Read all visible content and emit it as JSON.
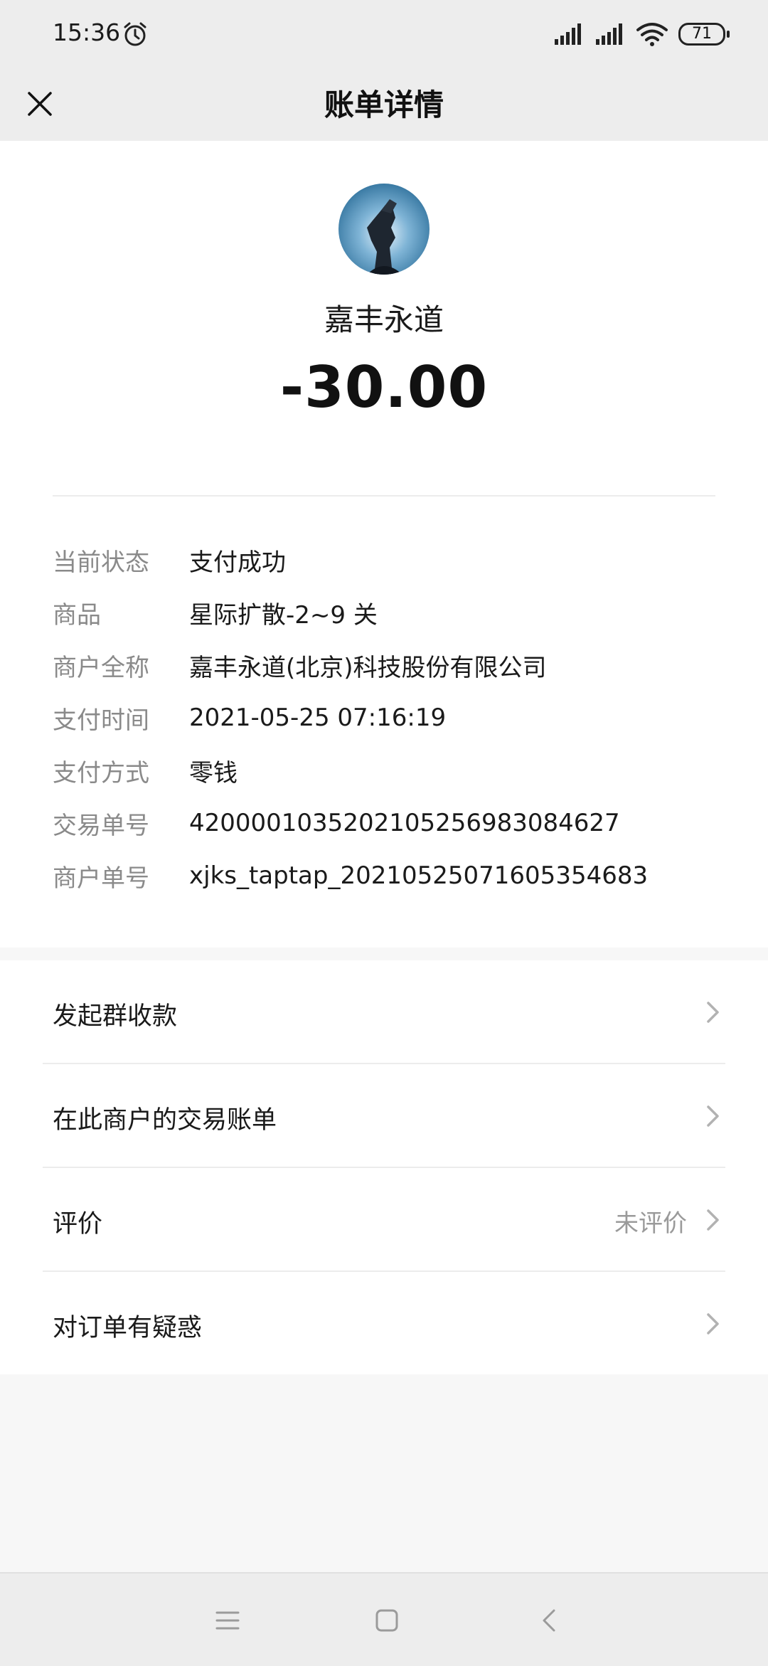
{
  "status_bar": {
    "time": "15:36",
    "battery": "71",
    "icons": [
      "alarm-icon",
      "signal-icon",
      "signal-icon",
      "wifi-icon",
      "battery-icon"
    ]
  },
  "header": {
    "title": "账单详情",
    "close_icon": "close-icon"
  },
  "summary": {
    "merchant": "嘉丰永道",
    "amount": "-30.00"
  },
  "details": [
    {
      "label": "当前状态",
      "value": "支付成功"
    },
    {
      "label": "商品",
      "value": "星际扩散-2~9 关"
    },
    {
      "label": "商户全称",
      "value": "嘉丰永道(北京)科技股份有限公司"
    },
    {
      "label": "支付时间",
      "value": "2021-05-25 07:16:19"
    },
    {
      "label": "支付方式",
      "value": "零钱"
    },
    {
      "label": "交易单号",
      "value": "4200001035202105256983084627"
    },
    {
      "label": "商户单号",
      "value": "xjks_taptap_20210525071605354683"
    }
  ],
  "actions": [
    {
      "label": "发起群收款",
      "right": ""
    },
    {
      "label": "在此商户的交易账单",
      "right": ""
    },
    {
      "label": "评价",
      "right": "未评价"
    },
    {
      "label": "对订单有疑惑",
      "right": ""
    }
  ],
  "nav": [
    "menu-icon",
    "home-icon",
    "back-icon"
  ]
}
